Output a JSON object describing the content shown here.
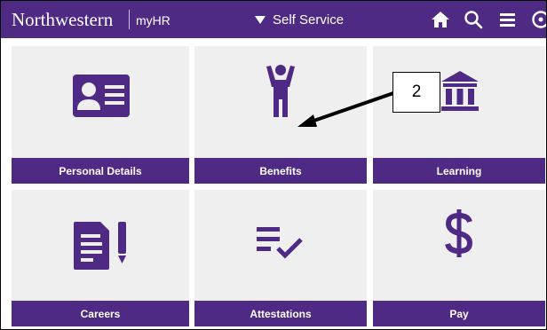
{
  "header": {
    "brand": "Northwestern",
    "brand_sub": "myHR",
    "nav_title": "Self Service",
    "icons": [
      "home-icon",
      "search-icon",
      "menu-icon",
      "compass-icon"
    ]
  },
  "colors": {
    "accent": "#4e2a84",
    "tile_bg": "#efefef"
  },
  "tiles": [
    {
      "label": "Personal Details",
      "icon": "id-card-icon"
    },
    {
      "label": "Benefits",
      "icon": "person-arms-up-icon"
    },
    {
      "label": "Learning",
      "icon": "bank-building-icon"
    },
    {
      "label": "Careers",
      "icon": "document-pen-icon"
    },
    {
      "label": "Attestations",
      "icon": "checklist-icon"
    },
    {
      "label": "Pay",
      "icon": "dollar-icon"
    }
  ],
  "annotation": {
    "callout_number": "2"
  }
}
